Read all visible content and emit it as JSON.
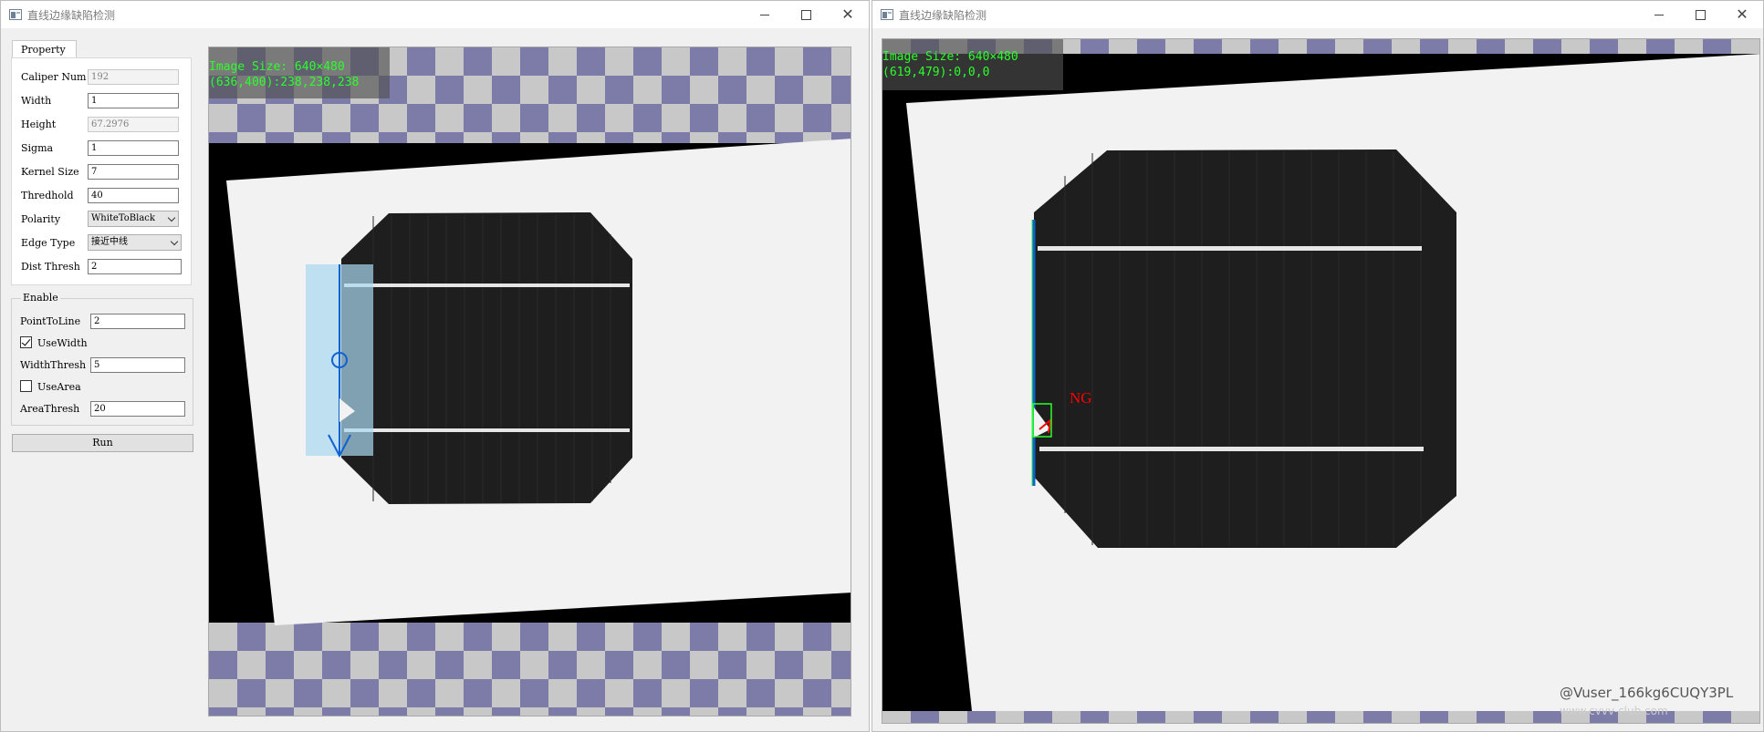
{
  "left_window": {
    "title": "直线边缘缺陷检测",
    "tab_label": "Property",
    "fields": [
      {
        "label": "Caliper Num",
        "value": "192",
        "disabled": true
      },
      {
        "label": "Width",
        "value": "1"
      },
      {
        "label": "Height",
        "value": "67.2976",
        "disabled": true
      },
      {
        "label": "Sigma",
        "value": "1"
      },
      {
        "label": "Kernel Size",
        "value": "7"
      },
      {
        "label": "Thredhold",
        "value": "40"
      },
      {
        "label": "Polarity",
        "value": "WhiteToBlack"
      },
      {
        "label": "Edge Type",
        "value": "接近中线"
      },
      {
        "label": "Dist Thresh",
        "value": "2"
      }
    ],
    "enable_group": {
      "title": "Enable",
      "point_to_line_label": "PointToLine",
      "point_to_line_value": "2",
      "use_width_label": "UseWidth",
      "use_width_checked": true,
      "width_thresh_label": "WidthThresh",
      "width_thresh_value": "5",
      "use_area_label": "UseArea",
      "use_area_checked": false,
      "area_thresh_label": "AreaThresh",
      "area_thresh_value": "20"
    },
    "run_label": "Run",
    "viewer": {
      "image_size": "Image Size: 640×480",
      "pixel_info": "(636,400):238,238,238"
    }
  },
  "right_window": {
    "title": "直线边缘缺陷检测",
    "viewer": {
      "image_size": "Image Size: 640×480",
      "pixel_info": "(619,479):0,0,0",
      "ng_label": "NG"
    },
    "watermark_line1": "@Vuser_166kg6CUQY3PL",
    "watermark_line2": "www.cvvv-club.com"
  },
  "colors": {
    "overlay_text": "#2bff2b",
    "caliper_fill": "#a8d8f0",
    "caliper_line": "#1060d0",
    "ng": "#ff0000",
    "checker_dark": "#7d7ba8",
    "checker_light": "#c8c8c8"
  }
}
